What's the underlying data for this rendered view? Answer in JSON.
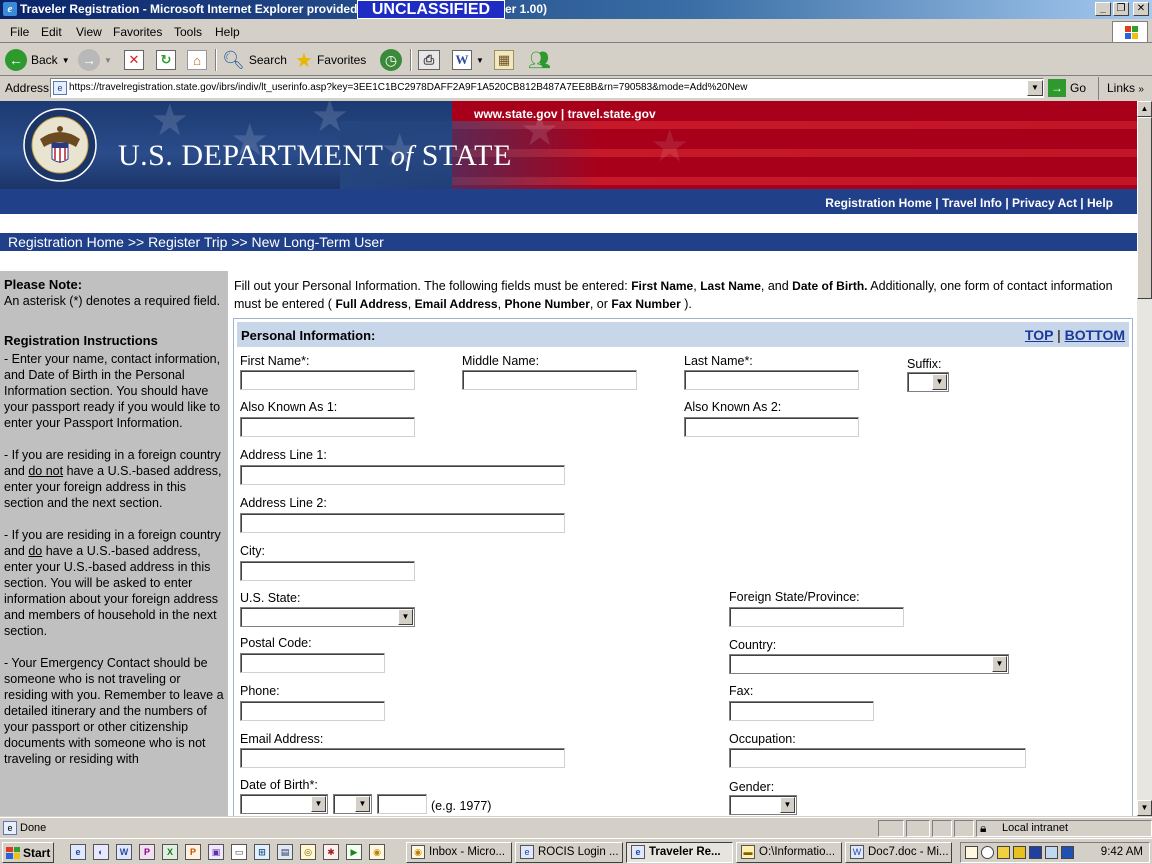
{
  "window": {
    "title": "Traveler Registration - Microsoft Internet Explorer provided by",
    "title_suffix": "er 1.00)",
    "classification": "UNCLASSIFIED"
  },
  "menu": [
    "File",
    "Edit",
    "View",
    "Favorites",
    "Tools",
    "Help"
  ],
  "toolbar": {
    "back": "Back",
    "search": "Search",
    "favorites": "Favorites"
  },
  "address": {
    "label": "Address",
    "url": "https://travelregistration.state.gov/ibrs/indiv/lt_userinfo.asp?key=3EE1C1BC2978DAFF2A9F1A520CB812B487A7EE8B&rn=790583&mode=Add%20New",
    "go": "Go",
    "links": "Links"
  },
  "banner": {
    "top_links": "www.state.gov | travel.state.gov",
    "dept_main": "U.S. DEPARTMENT",
    "dept_of": "of",
    "dept_state": "STATE",
    "nav_links": "Registration Home |  Travel Info |  Privacy Act |  Help"
  },
  "breadcrumb": "Registration Home  >>  Register Trip  >>  New Long-Term User",
  "sidebar": {
    "note_title": "Please Note:",
    "note_text": "An asterisk (*) denotes a required field.",
    "instr_title": "Registration Instructions",
    "p1": "- Enter your name, contact information, and Date of Birth in the Personal Information section. You should have your passport ready if you would like to enter your Passport Information.",
    "p2a": "- If you are residing in a foreign country and ",
    "p2u": "do not",
    "p2b": " have a U.S.-based address, enter your foreign address in this section and the next section.",
    "p3a": "- If you are residing in a foreign country and ",
    "p3u": "do",
    "p3b": " have a U.S.-based address, enter your U.S.-based address in this section. You will be asked to enter information about your foreign address and members of household in the next section.",
    "p4": "- Your Emergency Contact should be someone who is not traveling or residing with you. Remember to leave a detailed itinerary and the numbers of your passport or other citizenship documents with someone who is not traveling or residing with"
  },
  "intro": {
    "t1": "Fill out your Personal Information. The following fields must be entered: ",
    "b1": "First Name",
    "t2": ", ",
    "b2": "Last Name",
    "t3": ", and ",
    "b3": "Date of Birth.",
    "t4": "   Additionally, one form of contact information must be entered ( ",
    "b4": "Full Address",
    "t5": ", ",
    "b5": "Email Address",
    "t6": ", ",
    "b6": "Phone Number",
    "t7": ", or ",
    "b7": "Fax Number",
    "t8": " )."
  },
  "panel": {
    "title": "Personal Information:",
    "top": "TOP",
    "sep": "|",
    "bottom": "BOTTOM"
  },
  "fields": {
    "first_name": "First Name*:",
    "middle_name": "Middle Name:",
    "last_name": "Last Name*:",
    "suffix": "Suffix:",
    "aka1": "Also Known As 1:",
    "aka2": "Also Known As 2:",
    "addr1": "Address Line 1:",
    "addr2": "Address Line 2:",
    "city": "City:",
    "us_state": "U.S. State:",
    "foreign_state": "Foreign State/Province:",
    "postal": "Postal Code:",
    "country": "Country:",
    "phone": "Phone:",
    "fax": "Fax:",
    "email": "Email Address:",
    "occupation": "Occupation:",
    "dob": "Date of Birth*:",
    "dob_hint": "(e.g. 1977)",
    "gender": "Gender:"
  },
  "status": {
    "text": "Done",
    "zone": "Local intranet"
  },
  "taskbar": {
    "start": "Start",
    "tasks": [
      "Inbox - Micro...",
      "ROCIS Login ...",
      "Traveler Re...",
      "O:\\Informatio...",
      "Doc7.doc - Mi..."
    ],
    "clock": "9:42 AM"
  }
}
